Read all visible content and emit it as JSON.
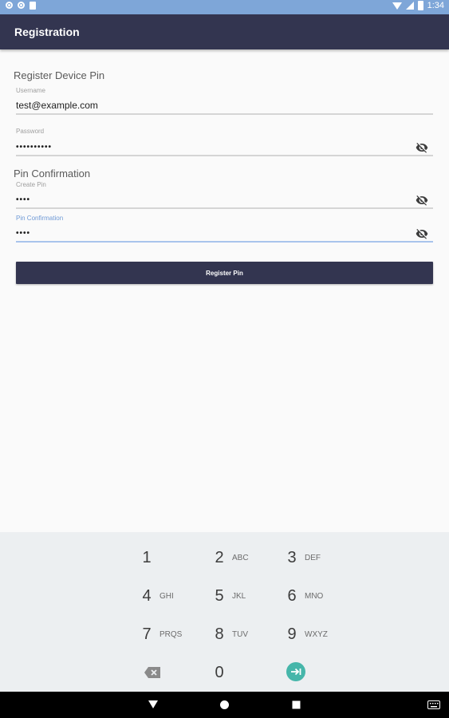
{
  "status_bar": {
    "time": "1:34"
  },
  "app_bar": {
    "title": "Registration"
  },
  "form": {
    "section1_title": "Register Device Pin",
    "username": {
      "label": "Username",
      "value": "test@example.com"
    },
    "password": {
      "label": "Password",
      "value": "••••••••••"
    },
    "section2_title": "Pin Confirmation",
    "create_pin": {
      "label": "Create Pin",
      "value": "••••"
    },
    "pin_confirmation": {
      "label": "Pin Confirmation",
      "value": "••••"
    },
    "register_button": "Register Pin"
  },
  "keyboard": {
    "keys": [
      {
        "num": "1",
        "letters": ""
      },
      {
        "num": "2",
        "letters": "ABC"
      },
      {
        "num": "3",
        "letters": "DEF"
      },
      {
        "num": "4",
        "letters": "GHI"
      },
      {
        "num": "5",
        "letters": "JKL"
      },
      {
        "num": "6",
        "letters": "MNO"
      },
      {
        "num": "7",
        "letters": "PRQS"
      },
      {
        "num": "8",
        "letters": "TUV"
      },
      {
        "num": "9",
        "letters": "WXYZ"
      },
      {
        "num": "0",
        "letters": ""
      }
    ],
    "delete_icon": "backspace-icon",
    "go_icon": "next-arrow-icon"
  },
  "colors": {
    "app_bar": "#333550",
    "status_bar": "#7ea6d8",
    "accent": "#46b6aa",
    "focus": "#6f9ad6"
  }
}
